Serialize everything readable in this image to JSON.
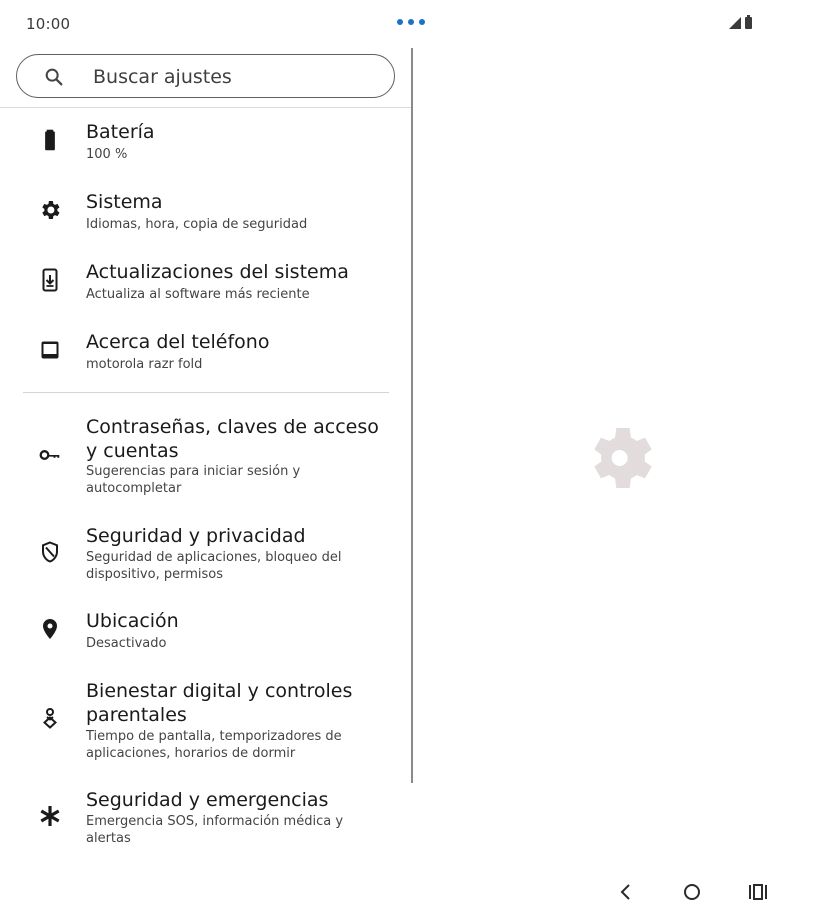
{
  "status": {
    "time": "10:00"
  },
  "search": {
    "placeholder": "Buscar ajustes"
  },
  "items": [
    {
      "title": "Batería",
      "subtitle": "100 %",
      "icon": "battery-icon"
    },
    {
      "title": "Sistema",
      "subtitle": "Idiomas, hora, copia de seguridad",
      "icon": "gear-icon"
    },
    {
      "title": "Actualizaciones del sistema",
      "subtitle": "Actualiza al software más reciente",
      "icon": "system-update-icon"
    },
    {
      "title": "Acerca del teléfono",
      "subtitle": "motorola razr fold",
      "icon": "phone-icon"
    },
    {
      "title": "Contraseñas, claves de acceso y cuentas",
      "subtitle": "Sugerencias para iniciar sesión y autocompletar",
      "icon": "key-icon"
    },
    {
      "title": "Seguridad y privacidad",
      "subtitle": "Seguridad de aplicaciones, bloqueo del dispositivo, permisos",
      "icon": "shield-icon"
    },
    {
      "title": "Ubicación",
      "subtitle": "Desactivado",
      "icon": "location-pin-icon"
    },
    {
      "title": "Bienestar digital y controles parentales",
      "subtitle": "Tiempo de pantalla, temporizadores de aplicaciones, horarios de dormir",
      "icon": "wellbeing-icon"
    },
    {
      "title": "Seguridad y emergencias",
      "subtitle": "Emergencia SOS, información médica y alertas",
      "icon": "asterisk-icon"
    }
  ],
  "colors": {
    "accent": "#1a73c8",
    "placeholder_gear": "#e3dcdc"
  }
}
